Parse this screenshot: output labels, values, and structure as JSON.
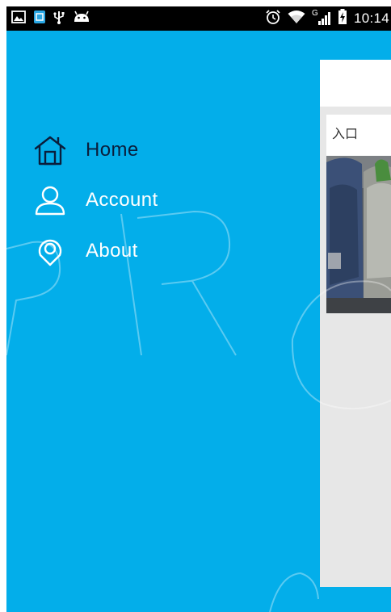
{
  "status_bar": {
    "time": "10:14",
    "network_type": "G",
    "left_icons": [
      "image-icon",
      "sim-app-icon",
      "usb-icon",
      "android-icon"
    ],
    "right_icons": [
      "alarm-icon",
      "wifi-icon",
      "cell-signal-icon",
      "battery-charging-icon"
    ]
  },
  "drawer": {
    "items": [
      {
        "label": "Home",
        "icon": "home-icon",
        "selected": true
      },
      {
        "label": "Account",
        "icon": "account-icon",
        "selected": false
      },
      {
        "label": "About",
        "icon": "about-icon",
        "selected": false
      }
    ]
  },
  "content": {
    "card": {
      "title": "入口"
    }
  },
  "colors": {
    "drawer_bg": "#03aeea",
    "selected_text": "#0a1e3c",
    "text": "#ffffff",
    "content_bg": "#e7e7e7"
  }
}
